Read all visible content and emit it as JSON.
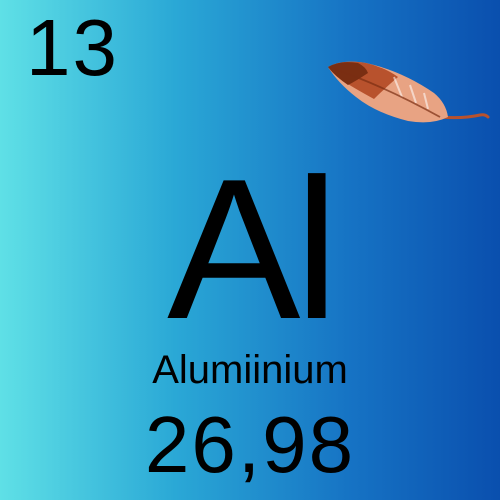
{
  "element": {
    "atomic_number": "13",
    "symbol": "Al",
    "name": "Alumiinium",
    "atomic_mass": "26,98"
  },
  "icon": {
    "name": "feather-icon",
    "colors": {
      "dark": "#7a2e12",
      "mid": "#b8522d",
      "light": "#e8a383"
    }
  },
  "colors": {
    "gradient_left": "#5fe0e6",
    "gradient_right": "#0a4fae",
    "text": "#000000"
  }
}
